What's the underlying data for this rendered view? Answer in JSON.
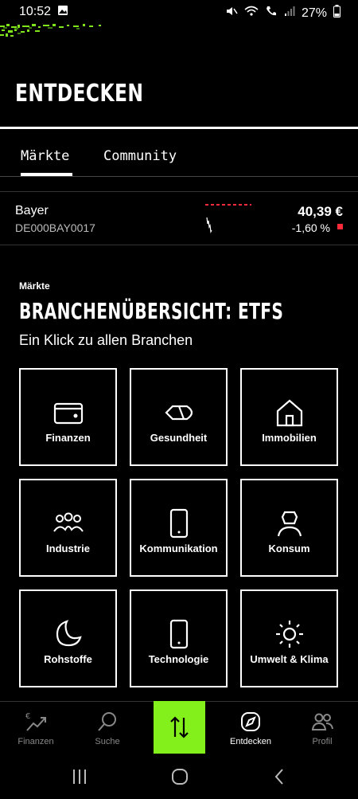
{
  "status_bar": {
    "time": "10:52",
    "battery": "27%"
  },
  "header": {
    "title": "ENTDECKEN"
  },
  "tabs": [
    {
      "label": "Märkte",
      "active": true
    },
    {
      "label": "Community",
      "active": false
    }
  ],
  "ticker": {
    "name": "Bayer",
    "isin": "DE000BAY0017",
    "price": "40,39 €",
    "change": "-1,60 %"
  },
  "section": {
    "eyebrow": "Märkte",
    "title": "BRANCHENÜBERSICHT: ETFS",
    "subtitle": "Ein Klick zu allen Branchen",
    "tiles": [
      {
        "label": "Finanzen",
        "icon": "wallet-icon"
      },
      {
        "label": "Gesundheit",
        "icon": "pill-icon"
      },
      {
        "label": "Immobilien",
        "icon": "house-icon"
      },
      {
        "label": "Industrie",
        "icon": "people-icon"
      },
      {
        "label": "Kommunikation",
        "icon": "phone-icon"
      },
      {
        "label": "Konsum",
        "icon": "person-icon"
      },
      {
        "label": "Rohstoffe",
        "icon": "moon-icon"
      },
      {
        "label": "Technologie",
        "icon": "phone-icon"
      },
      {
        "label": "Umwelt & Klima",
        "icon": "sun-icon"
      }
    ]
  },
  "bottom_nav": [
    {
      "label": "Finanzen",
      "icon": "chart-euro-icon"
    },
    {
      "label": "Suche",
      "icon": "search-icon"
    },
    {
      "label": "Entdecken",
      "icon": "compass-icon",
      "active": true
    },
    {
      "label": "Profil",
      "icon": "profile-icon"
    }
  ],
  "colors": {
    "accent": "#84f01b",
    "negative": "#ff2b3b",
    "background": "#000000"
  }
}
